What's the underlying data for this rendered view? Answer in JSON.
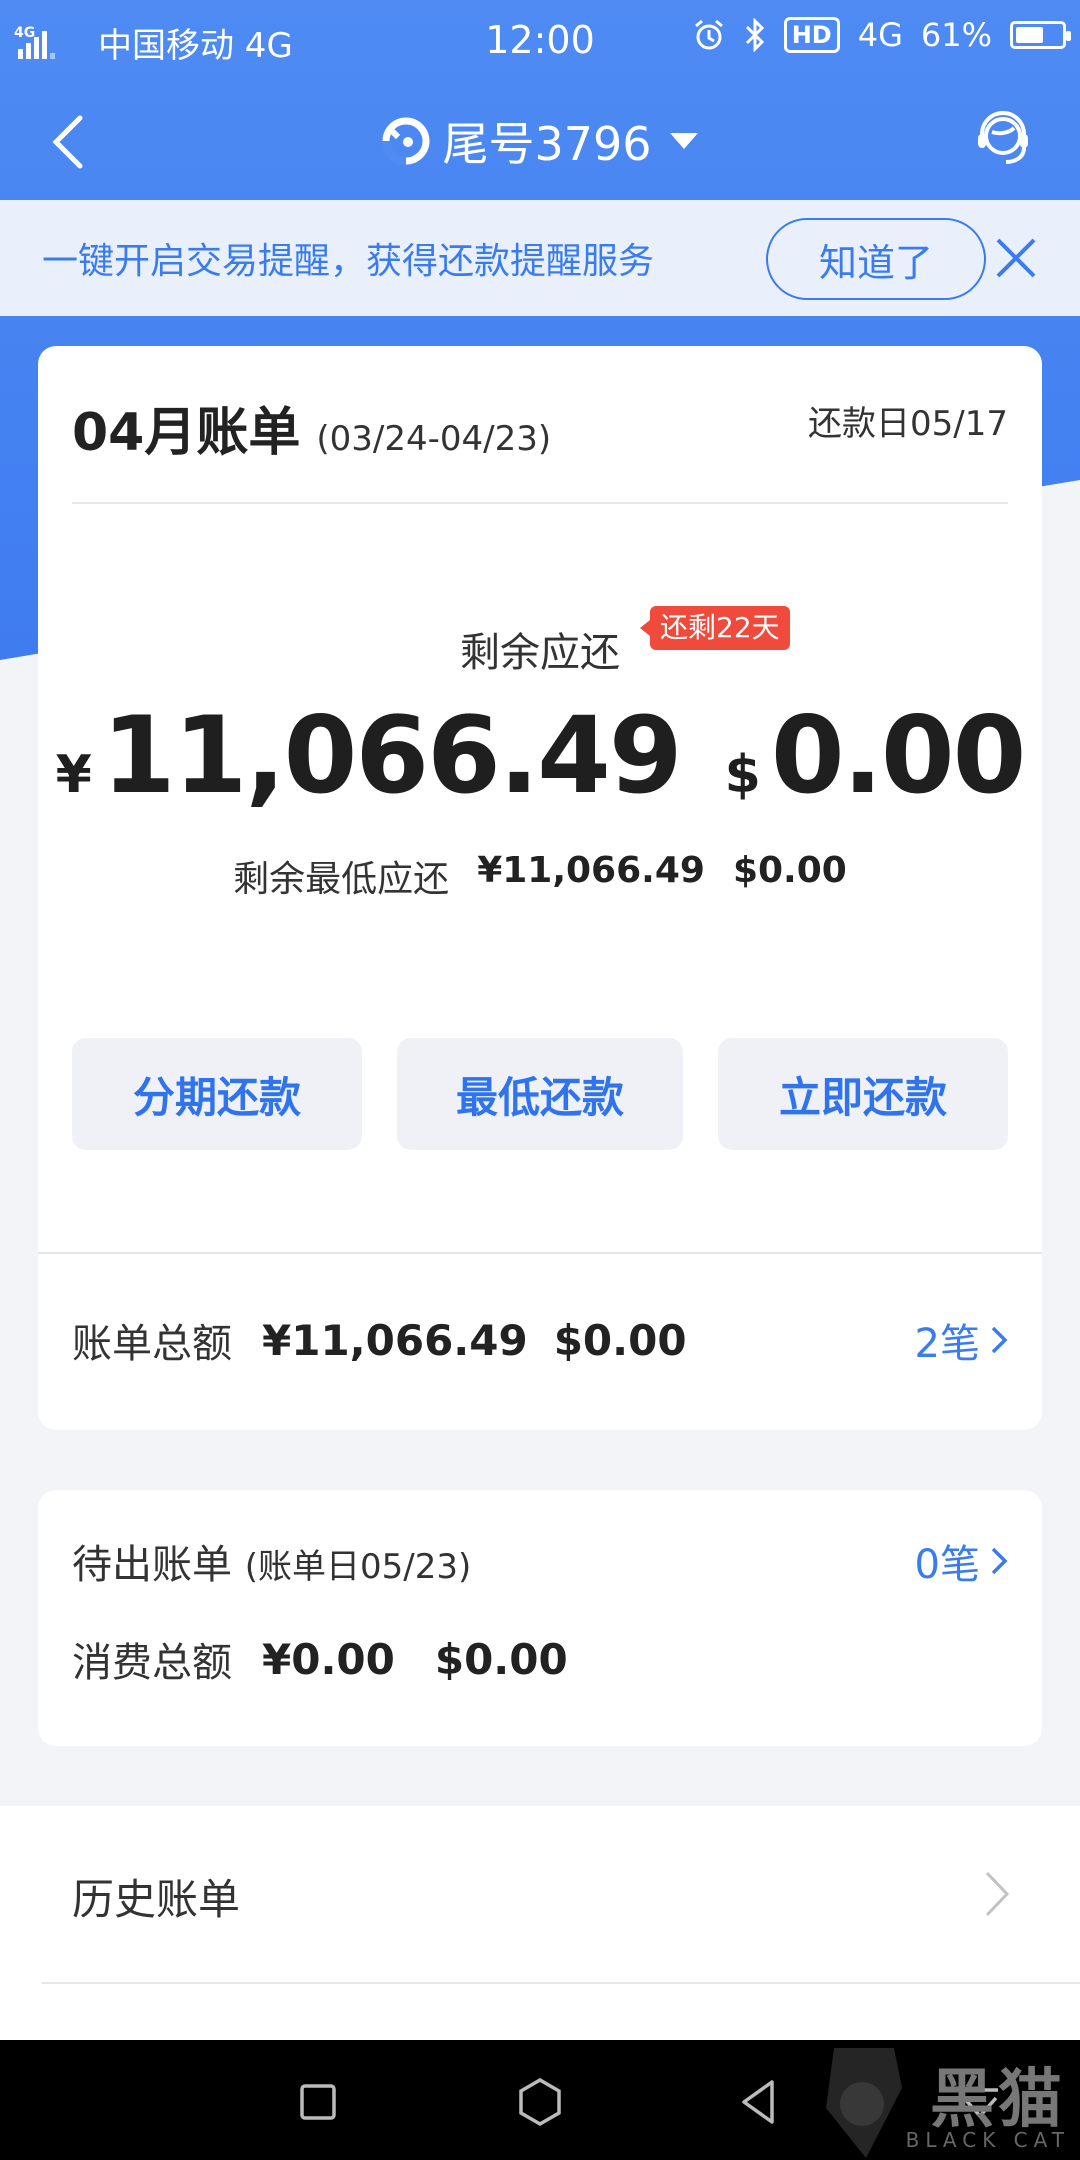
{
  "status_bar": {
    "network_tag": "4G",
    "carrier": "中国移动 4G",
    "time": "12:00",
    "network": "4G",
    "hd": "HD",
    "battery": "61%",
    "battery_level": 0.61
  },
  "nav": {
    "title": "尾号3796"
  },
  "banner": {
    "text": "一键开启交易提醒，获得还款提醒服务",
    "button": "知道了"
  },
  "bill": {
    "month": "04月账单",
    "period": "(03/24-04/23)",
    "due_date": "还款日05/17",
    "remain_label": "剩余应还",
    "days_left": "还剩22天",
    "rmb_symbol": "¥",
    "rmb_amount": "11,066.49",
    "usd_symbol": "$",
    "usd_amount": "0.00",
    "min_label": "剩余最低应还",
    "min_rmb": "¥11,066.49",
    "min_usd": "$0.00",
    "actions": {
      "installment": "分期还款",
      "minimum": "最低还款",
      "pay_now": "立即还款"
    },
    "total_label": "账单总额",
    "total_rmb": "¥11,066.49",
    "total_usd": "$0.00",
    "total_count": "2笔"
  },
  "pending": {
    "title": "待出账单",
    "bill_date": "(账单日05/23)",
    "count": "0笔",
    "spend_label": "消费总额",
    "spend_rmb": "¥0.00",
    "spend_usd": "$0.00"
  },
  "history": {
    "label": "历史账单"
  },
  "watermark": {
    "text": "黑猫",
    "sub": "BLACK CAT"
  }
}
